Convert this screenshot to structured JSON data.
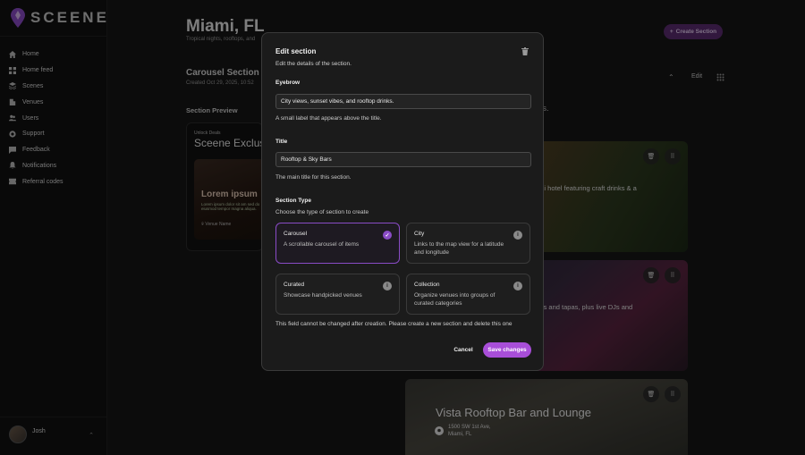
{
  "brand": {
    "name": "SCEENE",
    "accent": "#a84ed8"
  },
  "sidebar": {
    "items": [
      {
        "label": "Home",
        "icon": "home-icon"
      },
      {
        "label": "Home feed",
        "icon": "grid-icon"
      },
      {
        "label": "Scenes",
        "icon": "layers-icon"
      },
      {
        "label": "Venues",
        "icon": "building-icon"
      },
      {
        "label": "Users",
        "icon": "users-icon"
      },
      {
        "label": "Support",
        "icon": "support-icon"
      },
      {
        "label": "Feedback",
        "icon": "feedback-icon"
      },
      {
        "label": "Notifications",
        "icon": "bell-icon"
      },
      {
        "label": "Referral codes",
        "icon": "ticket-icon"
      }
    ],
    "user": {
      "name": "Josh"
    }
  },
  "page": {
    "title": "Miami, FL",
    "subtitle": "Tropical nights, rooftops, and",
    "create_label": "Create Section",
    "section_title": "Carousel Section",
    "section_created": "Created Oct 29, 2025, 10:52",
    "edit_label": "Edit",
    "preview_label": "Section Preview",
    "drinks_text": "inks."
  },
  "preview": {
    "eyebrow": "Unlock Deals",
    "title": "Sceene Exclus",
    "lorem_title": "Lorem ipsum",
    "lorem_body": "Lorem ipsum dolor sit am sed do eiusmod tempor magna aliqua.",
    "venue": "Venue Name"
  },
  "venues": [
    {
      "snippet": "ami hotel featuring craft drinks & a"
    },
    {
      "snippet": "tails and tapas, plus live DJs and"
    },
    {
      "name": "Vista Rooftop Bar and Lounge",
      "address_line1": "1500 SW 1st Ave,",
      "address_line2": "Miami, FL"
    }
  ],
  "modal": {
    "title": "Edit section",
    "description": "Edit the details of the section.",
    "eyebrow_label": "Eyebrow",
    "eyebrow_value": "City views, sunset vibes, and rooftop drinks.",
    "eyebrow_help": "A small label that appears above the title.",
    "title_label": "Title",
    "title_value": "Rooftop & Sky Bars",
    "title_help": "The main title for this section.",
    "type_label": "Section Type",
    "type_help": "Choose the type of section to create",
    "types": [
      {
        "title": "Carousel",
        "desc": "A scrollable carousel of items",
        "selected": true
      },
      {
        "title": "City",
        "desc": "Links to the map view for a latitude and longitude",
        "selected": false
      },
      {
        "title": "Curated",
        "desc": "Showcase handpicked venues",
        "selected": false
      },
      {
        "title": "Collection",
        "desc": "Organize venues into groups of curated categories",
        "selected": false
      }
    ],
    "warning": "This field cannot be changed after creation. Please create a new section and delete this one",
    "cancel_label": "Cancel",
    "save_label": "Save changes"
  }
}
